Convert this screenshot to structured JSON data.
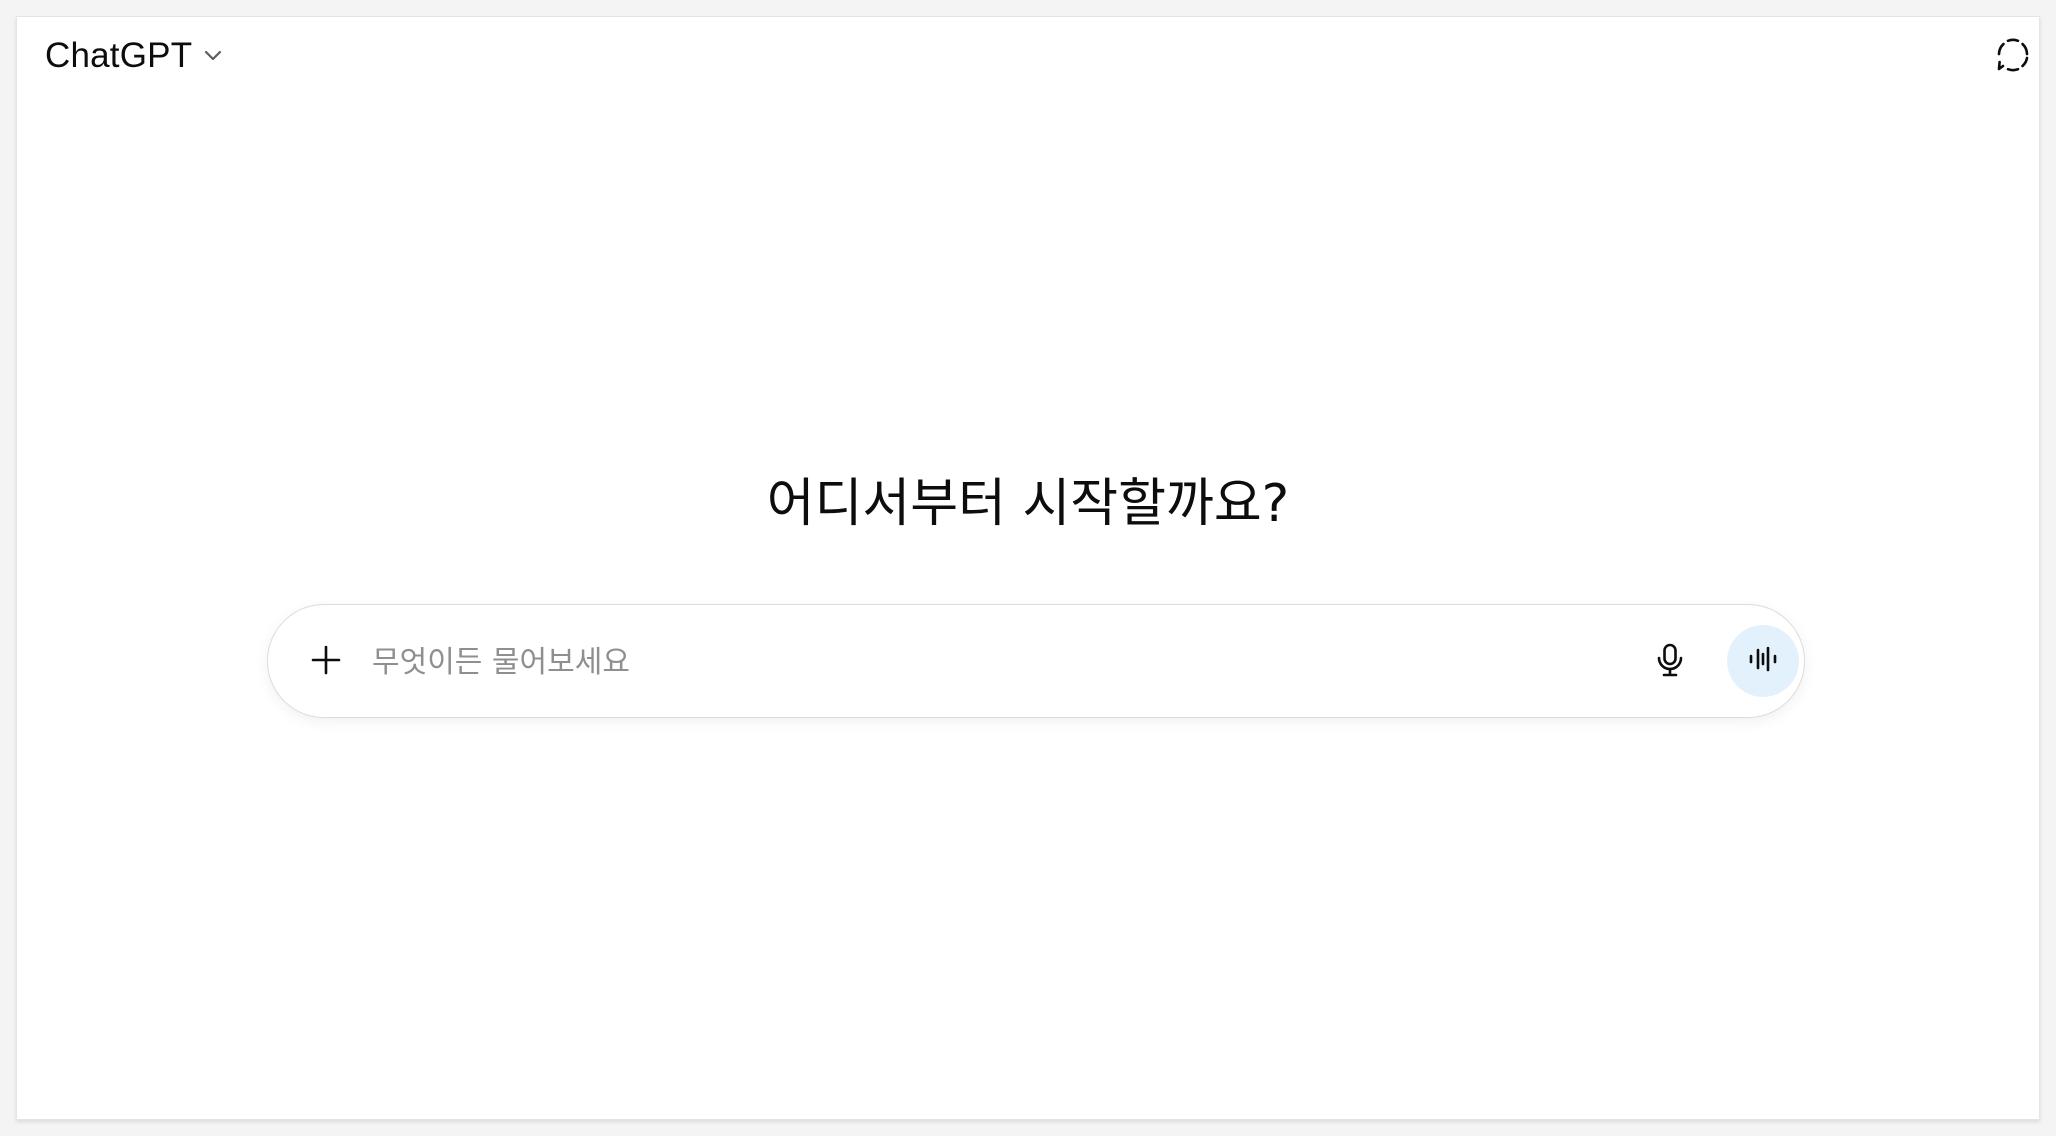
{
  "header": {
    "model_name": "ChatGPT",
    "model_chevron_icon": "chevron-down-icon",
    "temporary_chat_icon": "dashed-bubble-icon"
  },
  "main": {
    "headline": "어디서부터 시작할까요?"
  },
  "composer": {
    "placeholder": "무엇이든 물어보세요",
    "value": "",
    "attach_icon": "plus-icon",
    "dictate_icon": "microphone-icon",
    "voice_icon": "voice-waveform-icon"
  },
  "colors": {
    "text": "#0d0d0d",
    "placeholder": "#8f8f8f",
    "composer_border": "#dcdcdc",
    "voice_button_bg": "#e3f1fd",
    "page_bg": "#ffffff"
  }
}
